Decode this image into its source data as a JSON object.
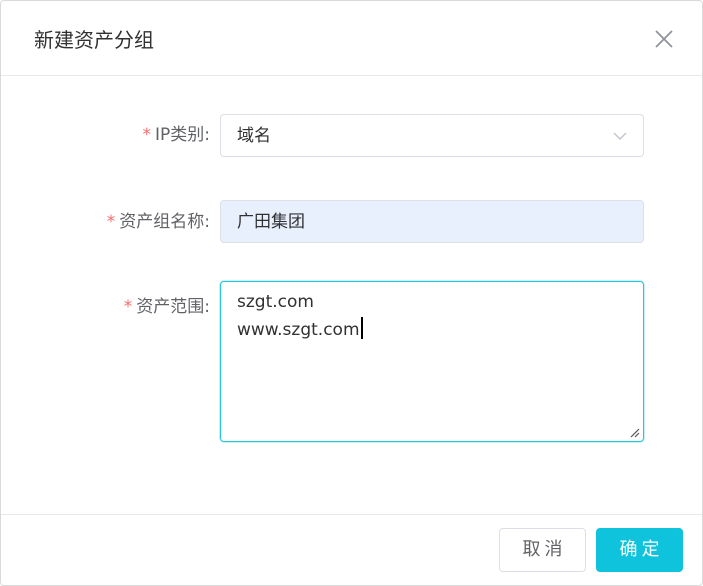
{
  "dialog": {
    "title": "新建资产分组"
  },
  "form": {
    "ip_type": {
      "label": "IP类别:",
      "required": "*",
      "value": "域名"
    },
    "group_name": {
      "label": "资产组名称:",
      "required": "*",
      "value": "广田集团"
    },
    "asset_range": {
      "label": "资产范围:",
      "required": "*",
      "lines": [
        "szgt.com",
        "www.szgt.com"
      ]
    }
  },
  "footer": {
    "cancel_label": "取消",
    "ok_label": "确定"
  },
  "colors": {
    "accent": "#0fc3dc",
    "required": "#f56c6c",
    "autofill_bg": "#e8f0fe"
  },
  "icons": {
    "close": "close-icon",
    "dropdown": "chevron-down-icon",
    "resize": "resize-handle-icon"
  }
}
